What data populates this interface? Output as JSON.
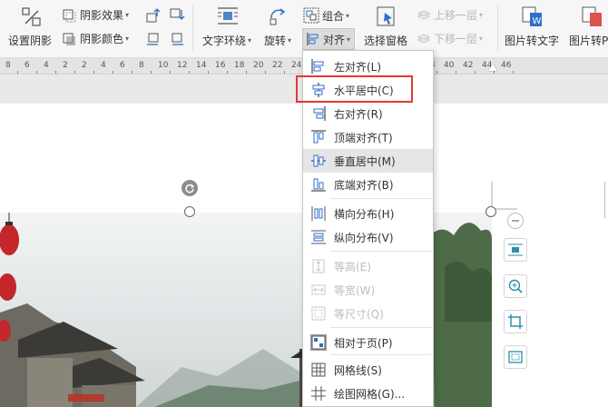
{
  "ribbon": {
    "shadow_settings": "设置阴影",
    "shadow_effect": "阴影效果",
    "shadow_color": "阴影颜色",
    "text_wrap": "文字环绕",
    "rotate": "旋转",
    "group": "组合",
    "align": "对齐",
    "selection_pane": "选择窗格",
    "move_up": "上移一层",
    "move_down": "下移一层",
    "image_to_text": "图片转文字",
    "image_to_pdf": "图片转P"
  },
  "ruler": {
    "labels": [
      "8",
      "6",
      "4",
      "2",
      "2",
      "4",
      "6",
      "8",
      "10",
      "12",
      "14",
      "16",
      "18",
      "20",
      "22",
      "24",
      "26",
      "28",
      "30",
      "32",
      "34",
      "36",
      "38",
      "40",
      "42",
      "44",
      "46"
    ]
  },
  "align_menu": {
    "items": [
      {
        "label": "左对齐(L)",
        "icon": "align-left-icon",
        "enabled": true
      },
      {
        "label": "水平居中(C)",
        "icon": "align-center-horizontal-icon",
        "enabled": true
      },
      {
        "label": "右对齐(R)",
        "icon": "align-right-icon",
        "enabled": true
      },
      {
        "label": "顶端对齐(T)",
        "icon": "align-top-icon",
        "enabled": true
      },
      {
        "label": "垂直居中(M)",
        "icon": "align-middle-vertical-icon",
        "enabled": true,
        "hover": true
      },
      {
        "label": "底端对齐(B)",
        "icon": "align-bottom-icon",
        "enabled": true
      },
      {
        "label": "横向分布(H)",
        "icon": "distribute-horizontal-icon",
        "enabled": true
      },
      {
        "label": "纵向分布(V)",
        "icon": "distribute-vertical-icon",
        "enabled": true
      },
      {
        "label": "等高(E)",
        "icon": "same-height-icon",
        "enabled": false
      },
      {
        "label": "等宽(W)",
        "icon": "same-width-icon",
        "enabled": false
      },
      {
        "label": "等尺寸(Q)",
        "icon": "same-size-icon",
        "enabled": false
      },
      {
        "label": "相对于页(P)",
        "icon": "relative-to-page-icon",
        "enabled": true
      },
      {
        "label": "网格线(S)",
        "icon": "gridlines-icon",
        "enabled": true
      },
      {
        "label": "绘图网格(G)...",
        "icon": "drawing-grid-icon",
        "enabled": true
      }
    ]
  },
  "colors": {
    "accent_blue": "#2f6fc9",
    "highlight_red": "#e53935",
    "icon_teal": "#2d8fa8"
  }
}
